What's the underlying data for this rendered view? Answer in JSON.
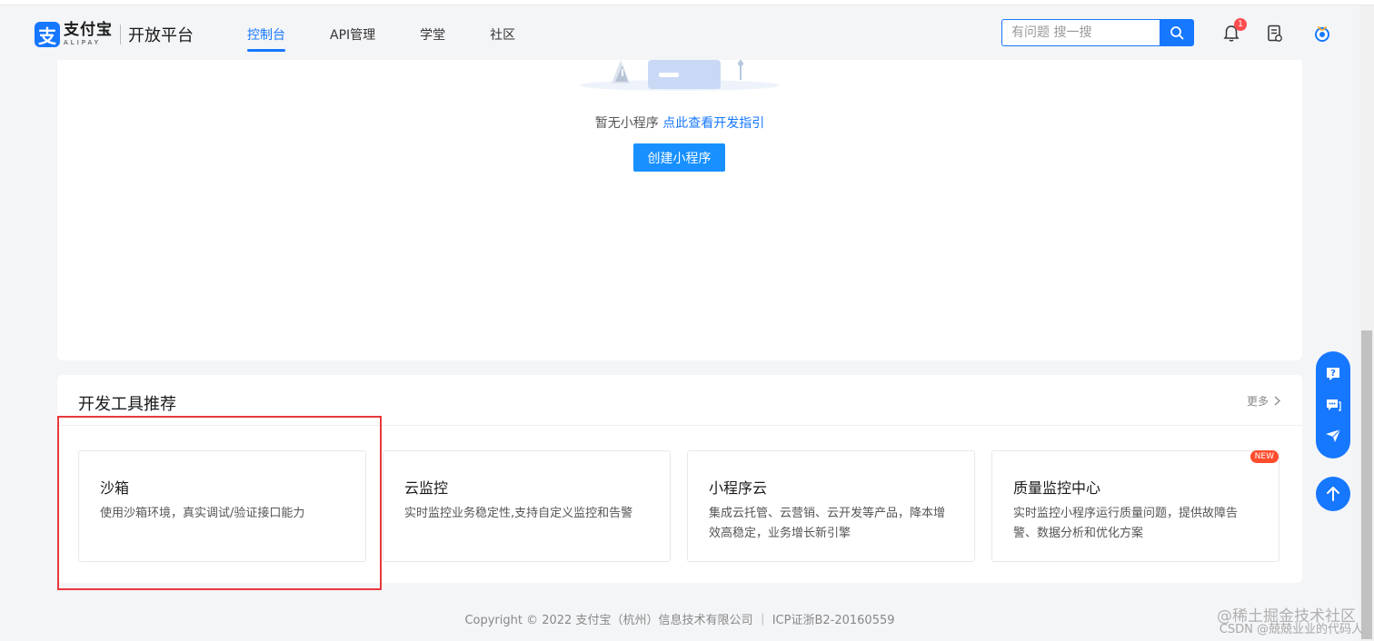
{
  "header": {
    "logo_cn": "支付宝",
    "logo_en": "ALIPAY",
    "logo_mark": "支",
    "platform": "开放平台",
    "nav": [
      {
        "label": "控制台",
        "active": true
      },
      {
        "label": "API管理",
        "active": false
      },
      {
        "label": "学堂",
        "active": false
      },
      {
        "label": "社区",
        "active": false
      }
    ],
    "search_placeholder": "有问题 搜一搜",
    "notification_count": "1"
  },
  "empty_state": {
    "text": "暂无小程序",
    "link": "点此查看开发指引",
    "button": "创建小程序"
  },
  "tools": {
    "title": "开发工具推荐",
    "more": "更多",
    "items": [
      {
        "name": "沙箱",
        "desc": "使用沙箱环境，真实调试/验证接口能力",
        "badge": ""
      },
      {
        "name": "云监控",
        "desc": "实时监控业务稳定性,支持自定义监控和告警",
        "badge": ""
      },
      {
        "name": "小程序云",
        "desc": "集成云托管、云营销、云开发等产品，降本增效高稳定，业务增长新引擎",
        "badge": ""
      },
      {
        "name": "质量监控中心",
        "desc": "实时监控小程序运行质量问题，提供故障告警、数据分析和优化方案",
        "badge": "NEW"
      }
    ]
  },
  "footer": {
    "text": "Copyright © 2022 支付宝（杭州）信息技术有限公司 ｜ ICP证浙B2-20160559"
  },
  "watermark": {
    "line1": "@稀土掘金技术社区",
    "line2": "CSDN @兢兢业业的代码人"
  },
  "colors": {
    "brand": "#1677ff",
    "highlight": "#e8383d"
  }
}
